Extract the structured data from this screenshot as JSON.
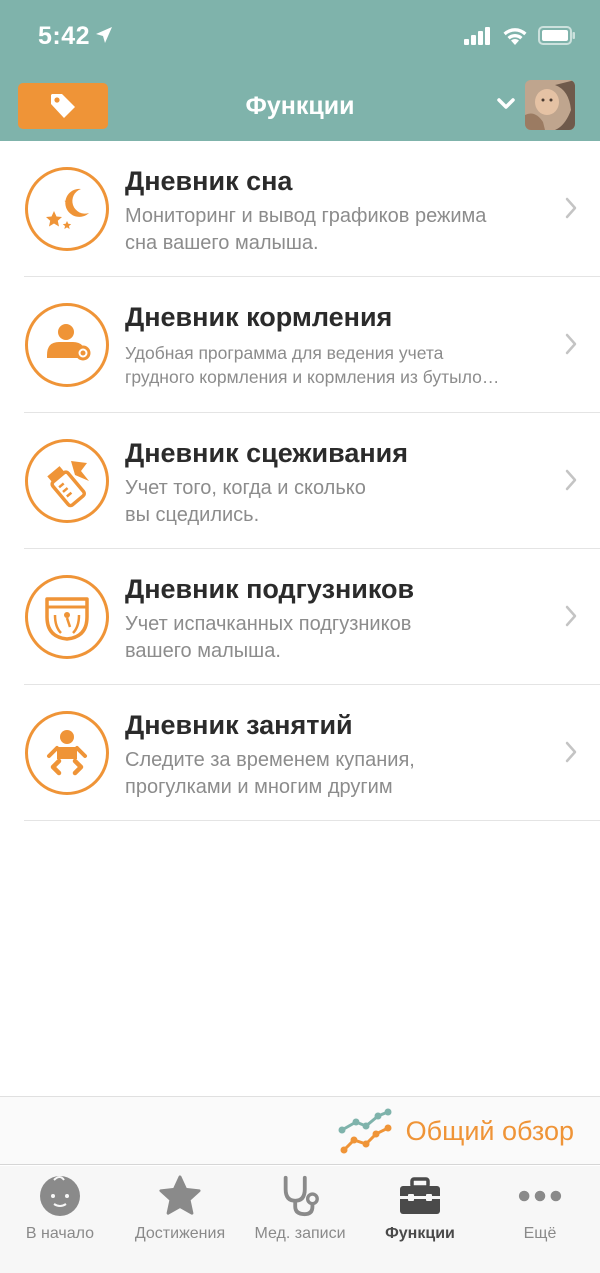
{
  "status_bar": {
    "time": "5:42"
  },
  "nav": {
    "title": "Функции"
  },
  "features": [
    {
      "title": "Дневник сна",
      "description": "Мониторинг и вывод графиков режима\nсна вашего малыша.",
      "icon": "sleep-moon-stars-icon"
    },
    {
      "title": "Дневник кормления",
      "description": "Удобная программа для ведения учета\nгрудного кормления и кормления из бутыло…",
      "icon": "breastfeeding-icon"
    },
    {
      "title": "Дневник сцеживания",
      "description": "Учет того, когда и сколько\nвы сцедились.",
      "icon": "breast-pump-bottle-icon"
    },
    {
      "title": "Дневник подгузников",
      "description": "Учет испачканных подгузников\nвашего малыша.",
      "icon": "diaper-icon"
    },
    {
      "title": "Дневник занятий",
      "description": "Следите за временем купания,\nпрогулками и многим другим",
      "icon": "baby-activity-icon"
    }
  ],
  "overview": {
    "label": "Общий обзор",
    "icon": "trend-chart-icon"
  },
  "tabs": [
    {
      "label": "В начало",
      "icon": "baby-face-icon",
      "active": false
    },
    {
      "label": "Достижения",
      "icon": "star-icon",
      "active": false
    },
    {
      "label": "Мед. записи",
      "icon": "stethoscope-icon",
      "active": false
    },
    {
      "label": "Функции",
      "icon": "toolbox-icon",
      "active": true
    },
    {
      "label": "Ещё",
      "icon": "more-dots-icon",
      "active": false
    }
  ],
  "colors": {
    "header": "#7fb3ab",
    "accent": "#ef9437",
    "title": "#2b2b2b",
    "subtitle": "#8c8c8c",
    "tab_inactive": "#8a8a8a",
    "tab_active": "#4a4a4a"
  }
}
